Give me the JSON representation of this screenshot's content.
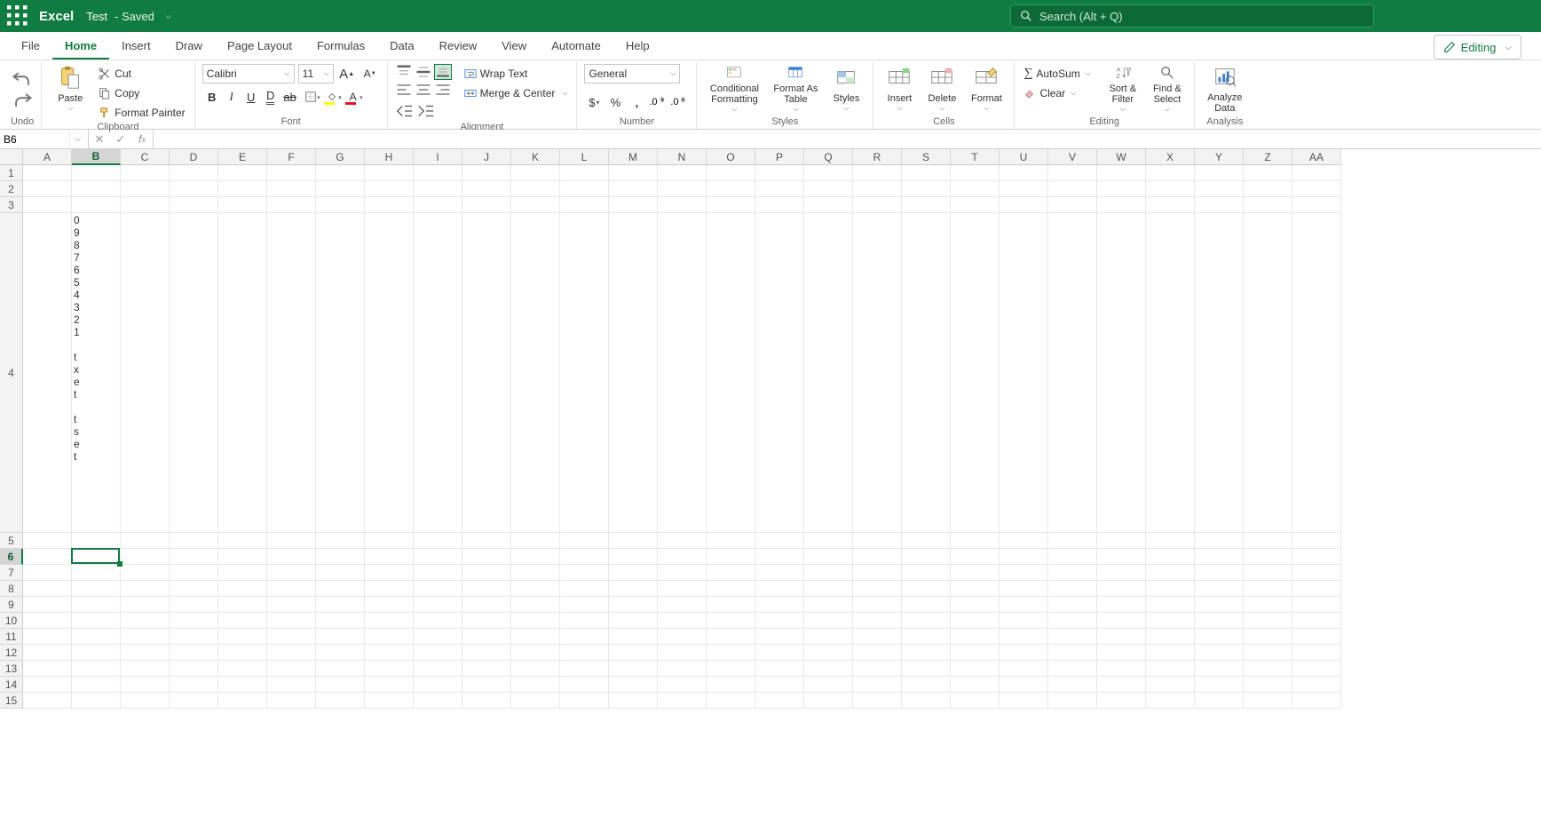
{
  "titlebar": {
    "app_name": "Excel",
    "doc_name": "Test",
    "doc_status": "-  Saved",
    "search_placeholder": "Search (Alt + Q)"
  },
  "tabs": {
    "file": "File",
    "home": "Home",
    "insert": "Insert",
    "draw": "Draw",
    "page_layout": "Page Layout",
    "formulas": "Formulas",
    "data": "Data",
    "review": "Review",
    "view": "View",
    "automate": "Automate",
    "help": "Help",
    "mode": "Editing"
  },
  "ribbon": {
    "undo": {
      "label": "Undo"
    },
    "clipboard": {
      "paste": "Paste",
      "cut": "Cut",
      "copy": "Copy",
      "format_painter": "Format Painter",
      "group": "Clipboard"
    },
    "font": {
      "name": "Calibri",
      "size": "11",
      "group": "Font",
      "fill_color": "#ffff00",
      "font_color": "#e81123"
    },
    "alignment": {
      "wrap": "Wrap Text",
      "merge": "Merge & Center",
      "group": "Alignment"
    },
    "number": {
      "format": "General",
      "group": "Number"
    },
    "styles": {
      "cond": "Conditional Formatting",
      "table": "Format As Table",
      "styles": "Styles",
      "group": "Styles"
    },
    "cells": {
      "insert": "Insert",
      "delete": "Delete",
      "format": "Format",
      "group": "Cells"
    },
    "editing": {
      "autosum": "AutoSum",
      "clear": "Clear",
      "sort": "Sort & Filter",
      "find": "Find & Select",
      "group": "Editing"
    },
    "analysis": {
      "analyze": "Analyze Data",
      "group": "Analysis"
    }
  },
  "formula_bar": {
    "name_box": "B6",
    "formula": ""
  },
  "grid": {
    "active_cell": {
      "col": 1,
      "row": 5
    },
    "columns": [
      "A",
      "B",
      "C",
      "D",
      "E",
      "F",
      "G",
      "H",
      "I",
      "J",
      "K",
      "L",
      "M",
      "N",
      "O",
      "P",
      "Q",
      "R",
      "S",
      "T",
      "U",
      "V",
      "W",
      "X",
      "Y",
      "Z",
      "AA"
    ],
    "row_count": 15,
    "row_heights": {
      "4": 360
    },
    "cells": {
      "B4": "0\n9\n8\n7\n6\n5\n4\n3\n2\n1\n\nt\nx\ne\nt\n\nt\ns\ne\nt"
    }
  }
}
